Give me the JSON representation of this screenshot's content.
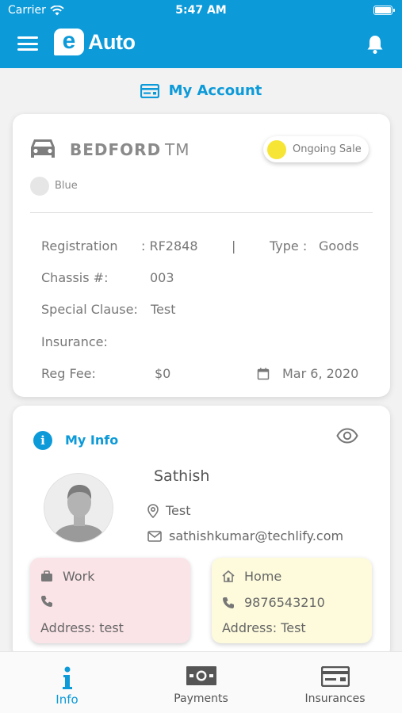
{
  "status_bar": {
    "carrier": "Carrier",
    "time": "5:47 AM"
  },
  "app": {
    "logo_letter": "e",
    "logo_word": "Auto"
  },
  "page": {
    "title": "My Account"
  },
  "vehicle": {
    "make": "BEDFORD",
    "model": "TM",
    "status": "Ongoing Sale",
    "color": "Blue",
    "registration_label": "Registration",
    "registration_value": ": RF2848",
    "separator": "|",
    "type_label": "Type :",
    "type_value": "Goods",
    "chassis_label": "Chassis #:",
    "chassis_value": "003",
    "clause_label": "Special Clause:",
    "clause_value": "Test",
    "insurance_label": "Insurance:",
    "fee_label": "Reg Fee:",
    "fee_value": "$0",
    "date_value": "Mar 6, 2020"
  },
  "my_info": {
    "title": "My Info",
    "name": "Sathish",
    "location": "Test",
    "email": "sathishkumar@techlify.com",
    "work": {
      "label": "Work",
      "phone": "",
      "address": "Address:  test"
    },
    "home": {
      "label": "Home",
      "phone": "9876543210",
      "address": "Address:  Test"
    }
  },
  "tabs": [
    {
      "label": "Info",
      "icon": "info-icon",
      "active": true
    },
    {
      "label": "Payments",
      "icon": "money-icon",
      "active": false
    },
    {
      "label": "Insurances",
      "icon": "card-icon",
      "active": false
    }
  ],
  "colors": {
    "primary": "#0d9ad9",
    "status_dot": "#f6e535",
    "work_bg": "#fbe4e8",
    "home_bg": "#fdfbdc"
  }
}
